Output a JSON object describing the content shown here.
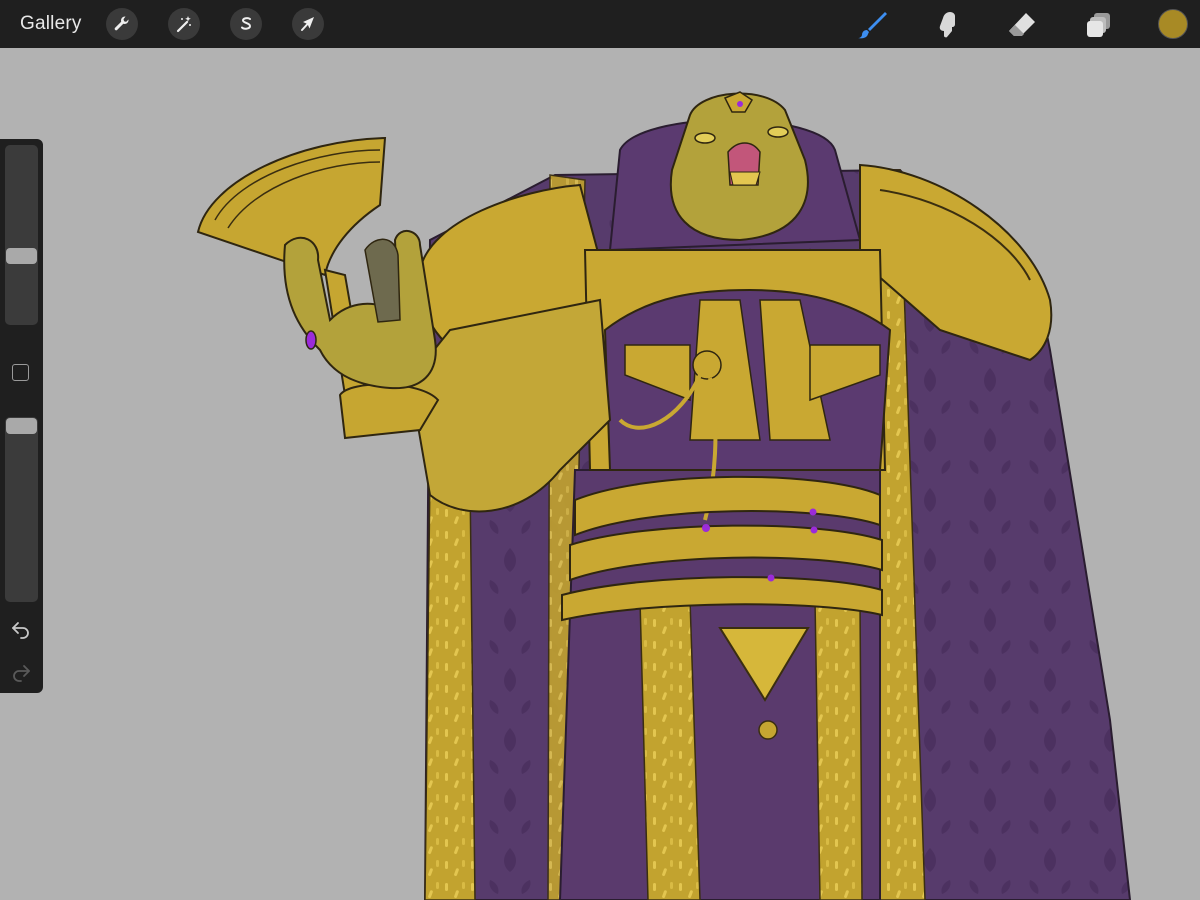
{
  "topbar": {
    "gallery_label": "Gallery",
    "left_tools": [
      "wrench-icon",
      "magic-wand-icon",
      "selection-icon",
      "transform-arrow-icon"
    ],
    "right_tools": [
      "brush-icon",
      "smudge-icon",
      "eraser-icon",
      "layers-icon"
    ],
    "active_tool": "brush-icon",
    "active_color": "#a88a25"
  },
  "sidebar": {
    "brush_size_level": 0.37,
    "opacity_level": 0.0,
    "modify_button": "modify-square-icon",
    "undo": "undo-icon",
    "redo": "redo-icon"
  },
  "artwork": {
    "palette": {
      "gold": "#c6a631",
      "purple": "#5b3a70",
      "dark_purple": "#47295a",
      "skin": "#b3a23b",
      "gem": "#9b2bd9"
    }
  }
}
